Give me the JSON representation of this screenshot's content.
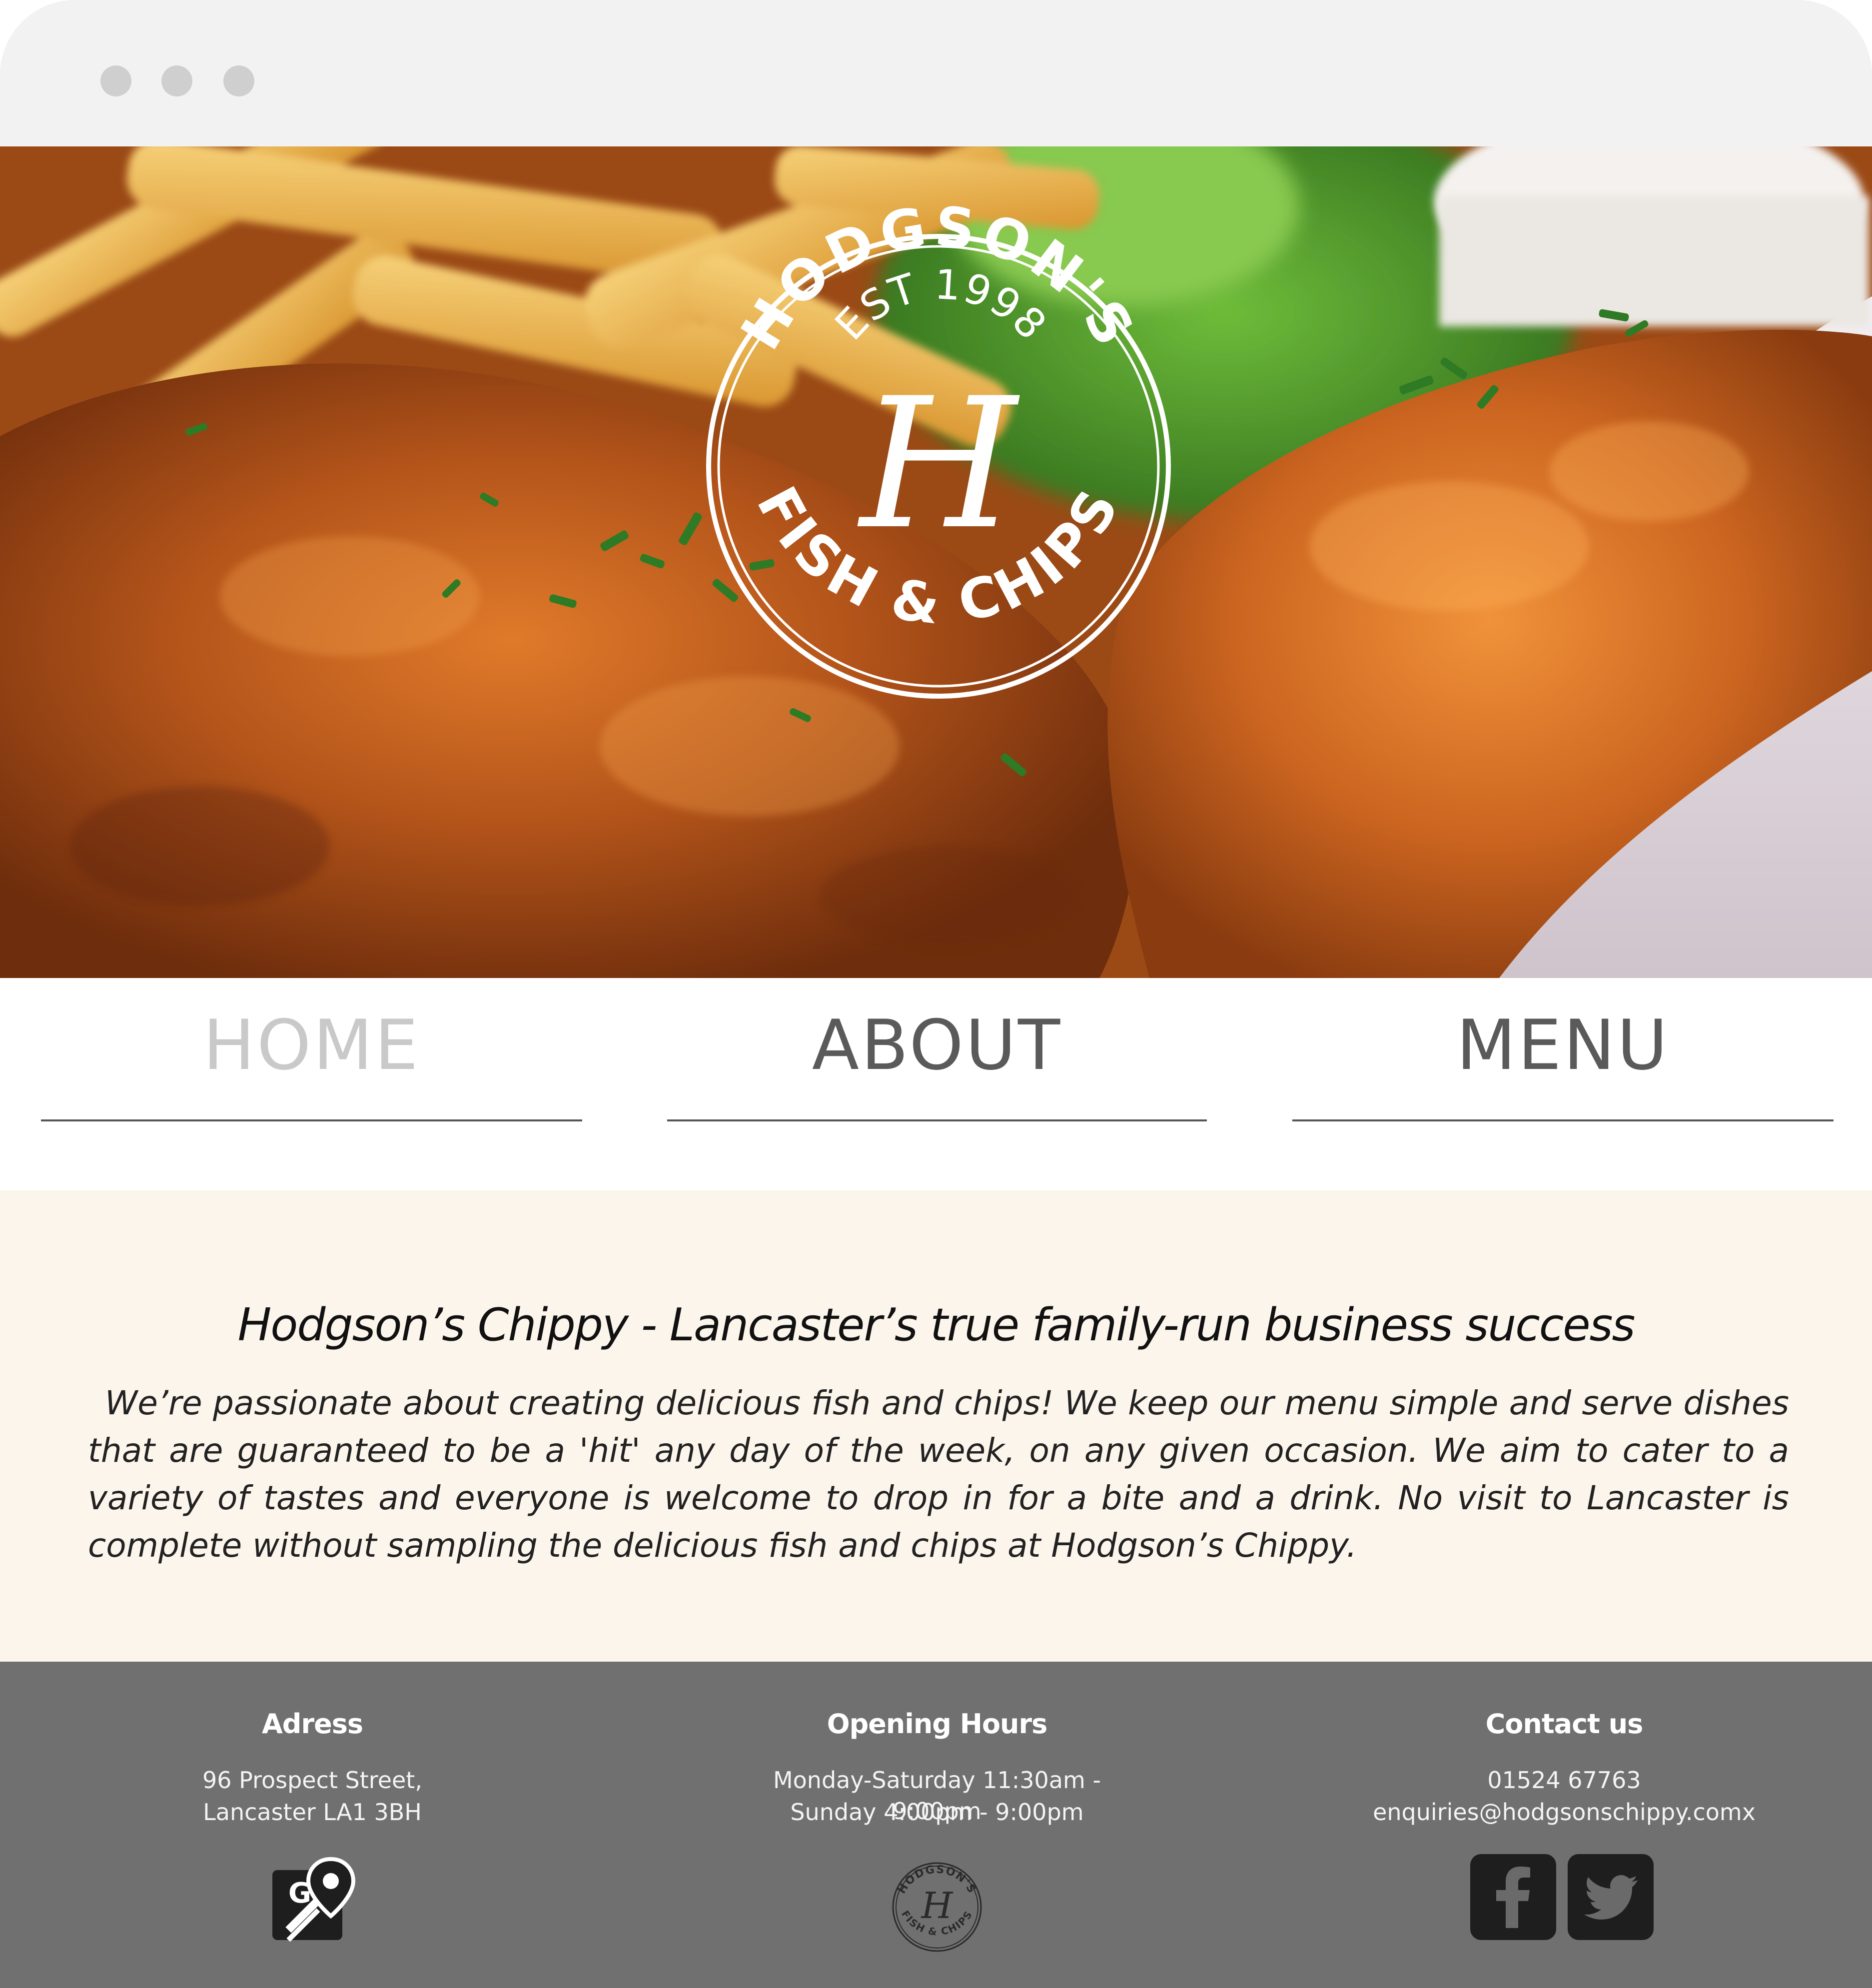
{
  "browser": {
    "window_controls": [
      "close-dot",
      "minimize-dot",
      "zoom-dot"
    ]
  },
  "hero": {
    "logo": {
      "name": "HODGSON'S",
      "established": "EST 1998",
      "monogram": "H",
      "tagline": "FISH & CHIPS"
    }
  },
  "nav": {
    "items": [
      {
        "label": "HOME",
        "active": true
      },
      {
        "label": "ABOUT",
        "active": false
      },
      {
        "label": "MENU",
        "active": false
      }
    ]
  },
  "about": {
    "title": "Hodgson’s Chippy - Lancaster’s true family-run business success",
    "body": "We’re passionate about creating delicious fish and chips! We keep our menu simple and serve dishes that are guaranteed to be a 'hit' any day of the week, on any given occasion. We aim to cater to a variety of tastes and everyone is welcome to drop in for a bite and a drink. No visit to Lancaster is complete without sampling the delicious fish and chips at Hodgson’s Chippy."
  },
  "footer": {
    "address": {
      "heading": "Adress",
      "line1": "96 Prospect Street,",
      "line2": "Lancaster LA1 3BH",
      "icon": "google-maps-icon"
    },
    "hours": {
      "heading": "Opening Hours",
      "line1": "Monday-Saturday 11:30am - 9:00pm",
      "line2": "Sunday 4:00pm - 9:00pm",
      "icon": "hodgsons-logo-small"
    },
    "contact": {
      "heading": "Contact us",
      "phone": "01524 67763",
      "email": "enquiries@hodgsonschippy.comx",
      "icons": [
        "facebook-icon",
        "twitter-icon"
      ]
    }
  },
  "colors": {
    "chrome": "#f2f2f2",
    "about_bg": "#fcf5ec",
    "footer_bg": "#707070",
    "nav_active": "#c9c9c9",
    "nav_text": "#5a5a5a",
    "social_bg": "#1e1e1e"
  }
}
